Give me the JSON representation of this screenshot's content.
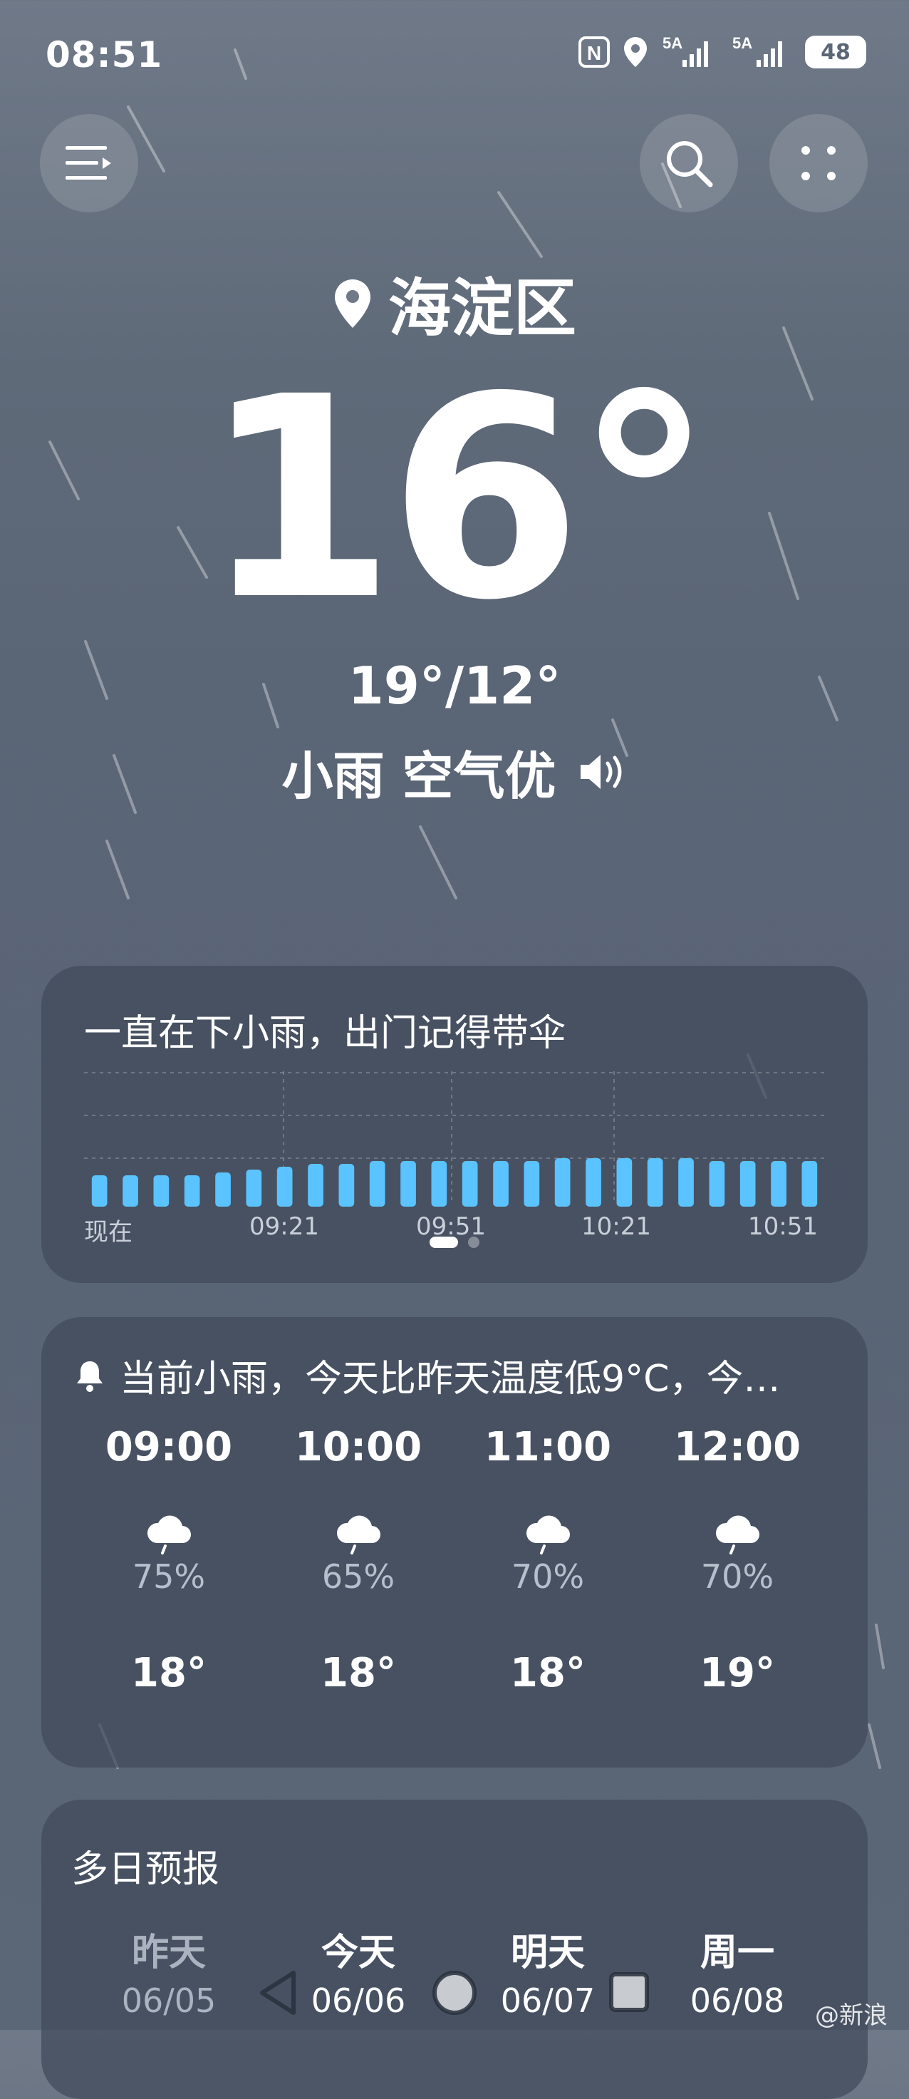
{
  "status_bar": {
    "time": "08:51",
    "signal1_label": "5A",
    "signal2_label": "5A",
    "battery": "48"
  },
  "header": {
    "menu_icon": "menu-icon",
    "search_icon": "search-icon",
    "more_icon": "more-dots-icon"
  },
  "location": {
    "name": "海淀区"
  },
  "current": {
    "temp": "16°",
    "range": "19°/12°",
    "condition": "小雨 空气优"
  },
  "rain_card": {
    "title": "一直在下小雨，出门记得带伞",
    "axis_labels": [
      "现在",
      "09:21",
      "09:51",
      "10:21",
      "10:51"
    ],
    "bar_levels": [
      0.55,
      0.55,
      0.55,
      0.55,
      0.6,
      0.65,
      0.7,
      0.75,
      0.75,
      0.8,
      0.8,
      0.8,
      0.8,
      0.8,
      0.8,
      0.85,
      0.85,
      0.85,
      0.85,
      0.85,
      0.8,
      0.8,
      0.8,
      0.8
    ],
    "page_count": 2,
    "active_page": 0,
    "accent": "#5bc3ff"
  },
  "hourly_card": {
    "alert": "当前小雨，今天比昨天温度低9°C，今…",
    "hours": [
      {
        "time": "09:00",
        "pct": "75%",
        "temp": "18°"
      },
      {
        "time": "10:00",
        "pct": "65%",
        "temp": "18°"
      },
      {
        "time": "11:00",
        "pct": "70%",
        "temp": "18°"
      },
      {
        "time": "12:00",
        "pct": "70%",
        "temp": "19°"
      }
    ]
  },
  "forecast_card": {
    "title": "多日预报",
    "days": [
      {
        "name": "昨天",
        "date": "06/05"
      },
      {
        "name": "今天",
        "date": "06/06"
      },
      {
        "name": "明天",
        "date": "06/07"
      },
      {
        "name": "周一",
        "date": "06/08"
      }
    ]
  },
  "watermark": "@新浪"
}
